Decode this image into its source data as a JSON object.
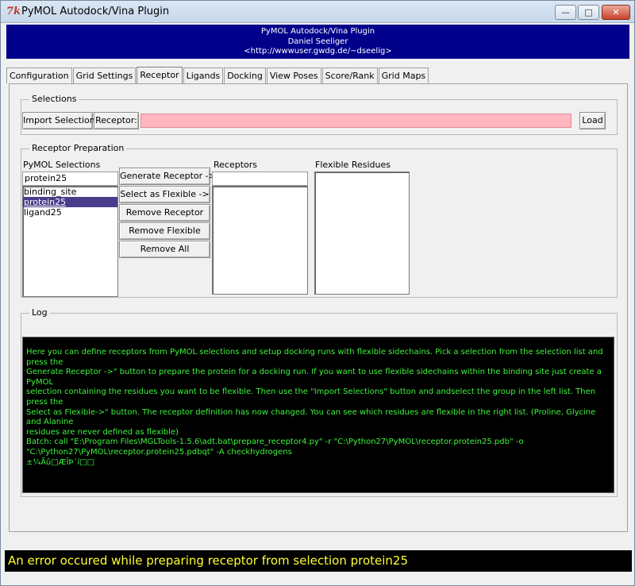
{
  "window": {
    "icon_glyph": "7k",
    "title": "PyMOL Autodock/Vina Plugin",
    "controls": {
      "minimize": "—",
      "maximize": "□",
      "close": "✕"
    }
  },
  "banner": {
    "line1": "PyMOL Autodock/Vina Plugin",
    "line2": "Daniel Seeliger",
    "line3": "<http://wwwuser.gwdg.de/~dseelig>",
    "bg_color": "#00008b"
  },
  "tabs": [
    {
      "label": "Configuration"
    },
    {
      "label": "Grid Settings"
    },
    {
      "label": "Receptor"
    },
    {
      "label": "Ligands"
    },
    {
      "label": "Docking"
    },
    {
      "label": "View Poses"
    },
    {
      "label": "Score/Rank"
    },
    {
      "label": "Grid Maps"
    }
  ],
  "active_tab": "Receptor",
  "selections": {
    "group_label": "Selections",
    "import_button": "Import Selections",
    "receptor_label": "Receptor:",
    "receptor_value": "",
    "load_button": "Load"
  },
  "receptor_prep": {
    "group_label": "Receptor Preparation",
    "pymol_selections_label": "PyMOL Selections",
    "selection_entry": "protein25",
    "selection_items": [
      "binding_site",
      "protein25",
      "ligand25"
    ],
    "selected_item": "protein25",
    "buttons": {
      "generate": "Generate Receptor ->",
      "select_flexible": "Select as Flexible ->",
      "remove_receptor": "Remove Receptor",
      "remove_flexible": "Remove Flexible",
      "remove_all": "Remove All"
    },
    "receptors_label": "Receptors",
    "receptors_entry": "",
    "flexible_label": "Flexible Residues"
  },
  "log": {
    "group_label": "Log",
    "lines": [
      "Here you can define receptors from PyMOL selections and setup docking runs with flexible sidechains. Pick a selection from the selection list and press the",
      "Generate Receptor ->\" button to prepare the protein for a docking run. If you want to use flexible sidechains within the binding site just create a PyMOL",
      "selection containing the residues you want to be flexible. Then use the \"Import Selections\" button and andselect the group in the left list. Then press the",
      "Select as Flexible->\" button. The receptor definition has now changed. You can see which residues are flexible in the right list. (Proline, Glycine and Alanine",
      "residues are never defined as flexible)",
      "Batch: call \"E:\\Program Files\\MGLTools-1.5.6\\adt.bat\\prepare_receptor4.py\" -r \"C:\\Python27\\PyMOL\\receptor.protein25.pdb\" -o",
      "\"C:\\Python27\\PyMOL\\receptor.protein25.pdbqt\" -A checkhydrogens",
      "±¼Ãû□ÆÎÞ´í□□"
    ],
    "text_color": "#3cf53c"
  },
  "status": {
    "message": "An error occured while preparing receptor from selection protein25",
    "text_color": "#ffff33"
  }
}
